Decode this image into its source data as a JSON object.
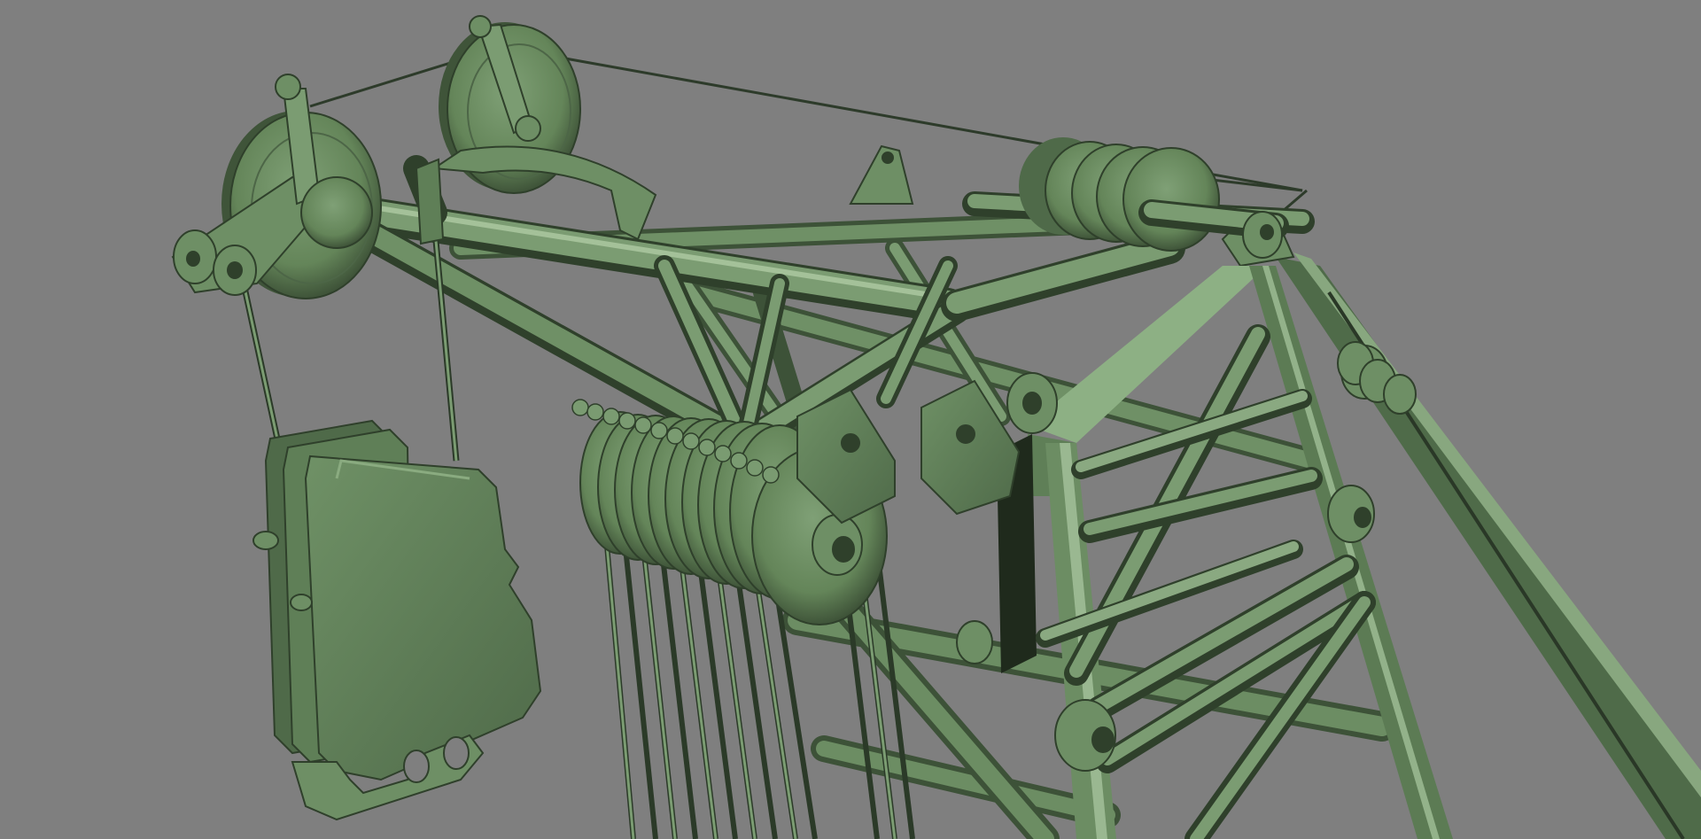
{
  "scene": {
    "subject": "crane-boom-top-render",
    "background_color": "#7f7f7f",
    "model_color": "#64855d",
    "model_highlight": "#8fb086",
    "model_shadow": "#1f2a1c",
    "cable_color": "#4e6b48"
  }
}
